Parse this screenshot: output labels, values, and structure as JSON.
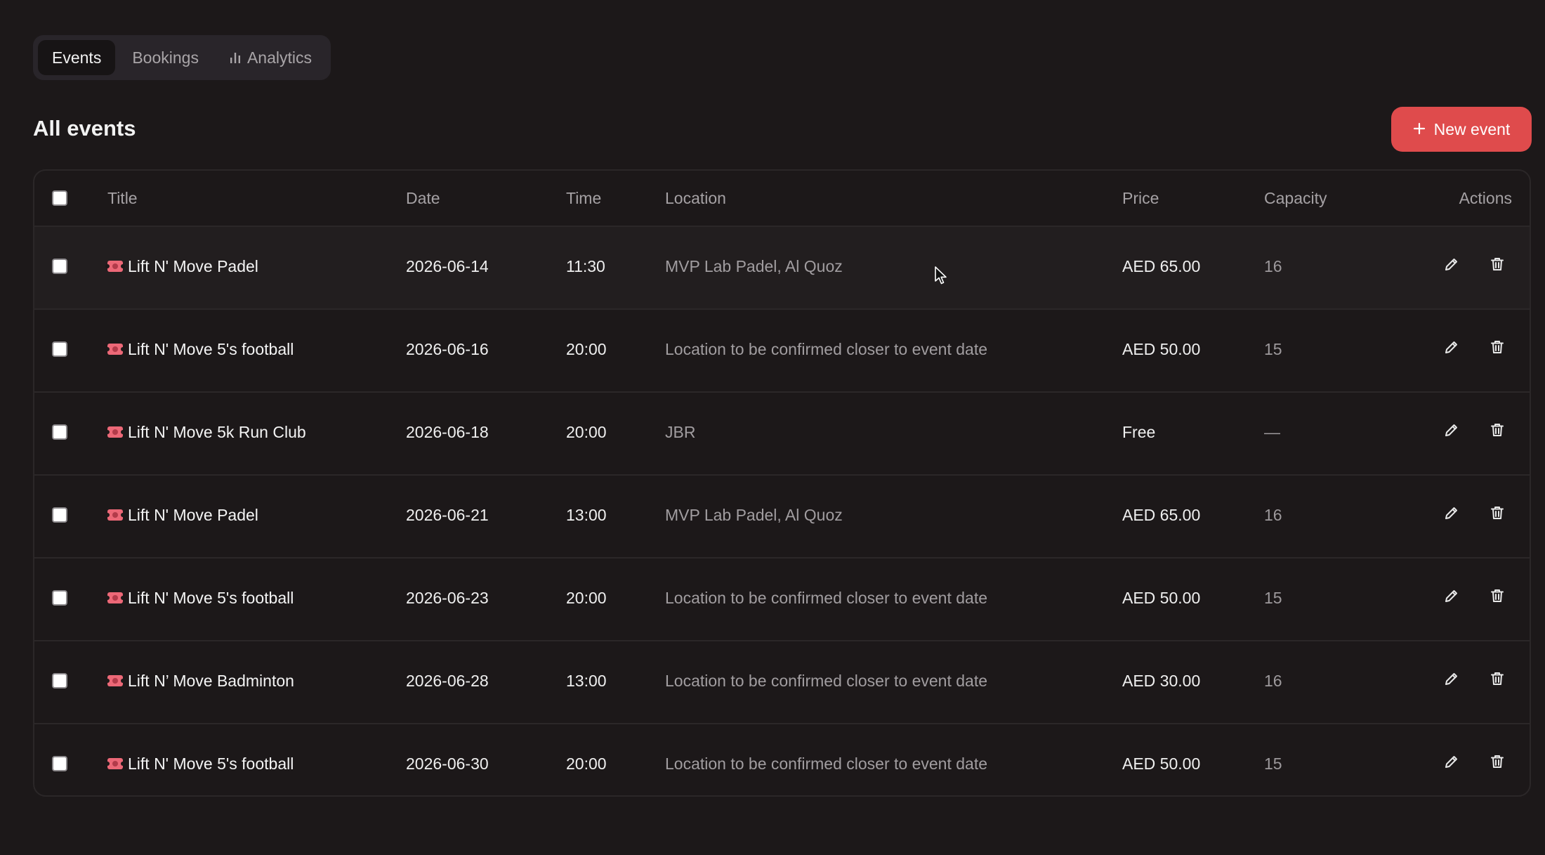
{
  "tabs": [
    {
      "label": "Events",
      "active": true
    },
    {
      "label": "Bookings",
      "active": false
    },
    {
      "label": "Analytics",
      "active": false,
      "icon": "bar-chart-icon"
    }
  ],
  "page": {
    "title": "All events",
    "new_button_label": "New event",
    "new_button_icon": "plus-icon"
  },
  "table": {
    "columns": [
      "Title",
      "Date",
      "Time",
      "Location",
      "Price",
      "Capacity",
      "Actions"
    ],
    "rows": [
      {
        "title": "Lift N' Move Padel",
        "date": "2026-06-14",
        "time": "11:30",
        "location": "MVP Lab Padel, Al Quoz",
        "price": "AED 65.00",
        "capacity": "16"
      },
      {
        "title": "Lift N' Move 5's football",
        "date": "2026-06-16",
        "time": "20:00",
        "location": "Location to be confirmed closer to event date",
        "price": "AED 50.00",
        "capacity": "15"
      },
      {
        "title": "Lift N' Move 5k Run Club",
        "date": "2026-06-18",
        "time": "20:00",
        "location": "JBR",
        "price": "Free",
        "capacity": "—"
      },
      {
        "title": "Lift N' Move Padel",
        "date": "2026-06-21",
        "time": "13:00",
        "location": "MVP Lab Padel, Al Quoz",
        "price": "AED 65.00",
        "capacity": "16"
      },
      {
        "title": "Lift N' Move 5's football",
        "date": "2026-06-23",
        "time": "20:00",
        "location": "Location to be confirmed closer to event date",
        "price": "AED 50.00",
        "capacity": "15"
      },
      {
        "title": "Lift N’ Move Badminton",
        "date": "2026-06-28",
        "time": "13:00",
        "location": "Location to be confirmed closer to event date",
        "price": "AED 30.00",
        "capacity": "16"
      },
      {
        "title": "Lift N' Move 5's football",
        "date": "2026-06-30",
        "time": "20:00",
        "location": "Location to be confirmed closer to event date",
        "price": "AED 50.00",
        "capacity": "15"
      }
    ]
  },
  "colors": {
    "background": "#1c1819",
    "accent": "#df4b4c",
    "ticket_icon": "#ec6877"
  }
}
